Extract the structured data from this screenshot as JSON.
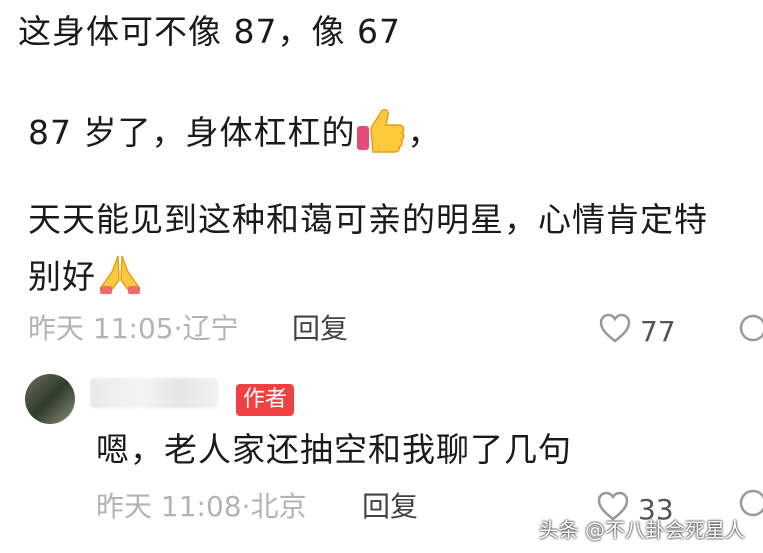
{
  "comment1": {
    "lines": [
      "这身体可不像 87，像 67",
      "87 岁了，身体杠杠的",
      "，",
      "天天能见到这种和蔼可亲的明星，心情肯定特",
      "别好"
    ],
    "time": "昨天 11:05",
    "location_sep": "·",
    "location": "辽宁",
    "reply_label": "回复",
    "likes": "77"
  },
  "reply": {
    "badge": "作者",
    "text": "嗯，老人家还抽空和我聊了几句",
    "time": "昨天 11:08",
    "location_sep": "·",
    "location": "北京",
    "reply_label": "回复",
    "likes": "33"
  },
  "watermark": "头条 @不八卦会死星人",
  "icons": {
    "thumbs_up": "thumbs-up-emoji",
    "pray": "pray-emoji",
    "heart": "heart-outline-icon"
  }
}
